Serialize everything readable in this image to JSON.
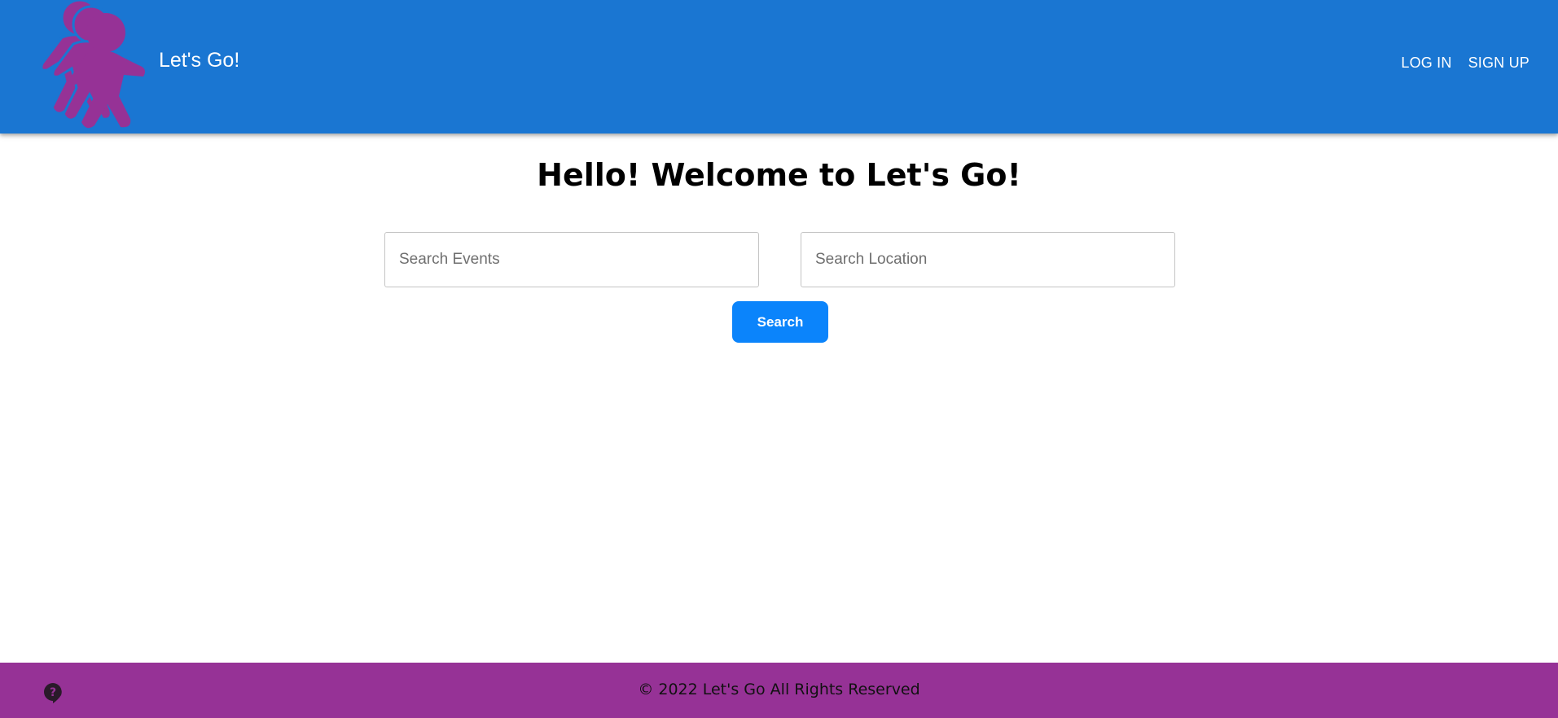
{
  "header": {
    "brand_title": "Let's Go!",
    "logo_icon": "people-walking-icon",
    "nav": {
      "login_label": "LOG IN",
      "signup_label": "SIGN UP"
    }
  },
  "main": {
    "heading": "Hello! Welcome to Let's Go!",
    "search_events": {
      "placeholder": "Search Events",
      "value": ""
    },
    "search_location": {
      "placeholder": "Search Location",
      "value": ""
    },
    "search_button_label": "Search"
  },
  "footer": {
    "copyright": "© 2022 Let's Go All Rights Reserved",
    "help_icon": "help-chat-icon"
  },
  "colors": {
    "header_bg": "#1a76d2",
    "logo_purple": "#963296",
    "button_blue": "#0b84fb",
    "footer_bg": "#963296"
  }
}
